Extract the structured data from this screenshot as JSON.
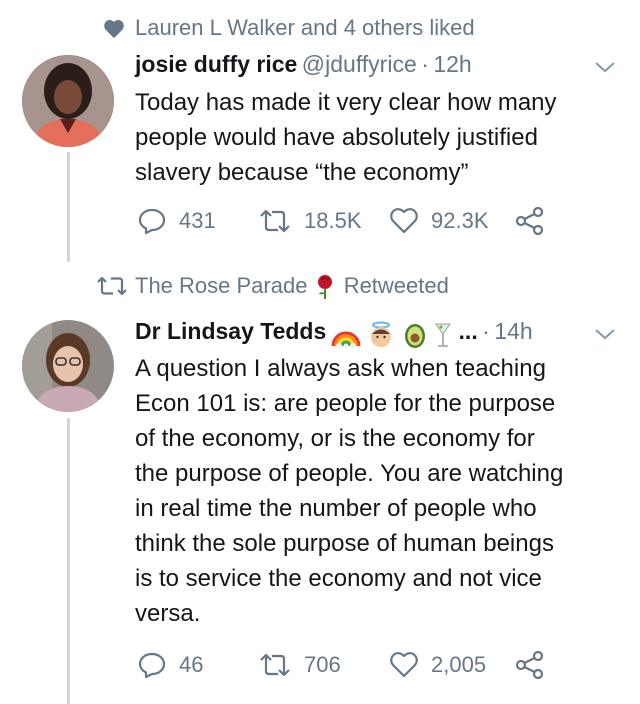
{
  "tweet1": {
    "context_text": "Lauren L Walker and 4 others liked",
    "name": "josie duffy rice",
    "handle": "@jduffyrice",
    "dot": "·",
    "time": "12h",
    "text": [
      "Today has made it very clear how many",
      "people would have absolutely justified",
      "slavery because “the economy”"
    ],
    "replies": "431",
    "retweets": "18.5K",
    "likes": "92.3K"
  },
  "tweet2": {
    "context_user": "The Rose Parade",
    "context_action": "Retweeted",
    "name": "Dr Lindsay Tedds",
    "ellipsis": "...",
    "dot": "·",
    "time": "14h",
    "text": [
      "A question I always ask when teaching",
      "Econ 101 is: are people for the purpose",
      "of the economy, or is the economy for",
      "the purpose of people. You are watching",
      "in real time the number of people who",
      "think the sole purpose of human beings",
      "is to service the economy and not vice",
      "versa."
    ],
    "replies": "46",
    "retweets": "706",
    "likes": "2,005"
  },
  "colors": {
    "text": "#14171a",
    "muted": "#657786",
    "line": "#ccd6dd",
    "rose": "#c0152a"
  },
  "icons": [
    "heart-icon",
    "chevron-down-icon",
    "reply-icon",
    "retweet-icon",
    "like-icon",
    "share-icon",
    "rose-icon",
    "rainbow-icon",
    "angel-icon",
    "avocado-icon",
    "cocktail-icon"
  ]
}
